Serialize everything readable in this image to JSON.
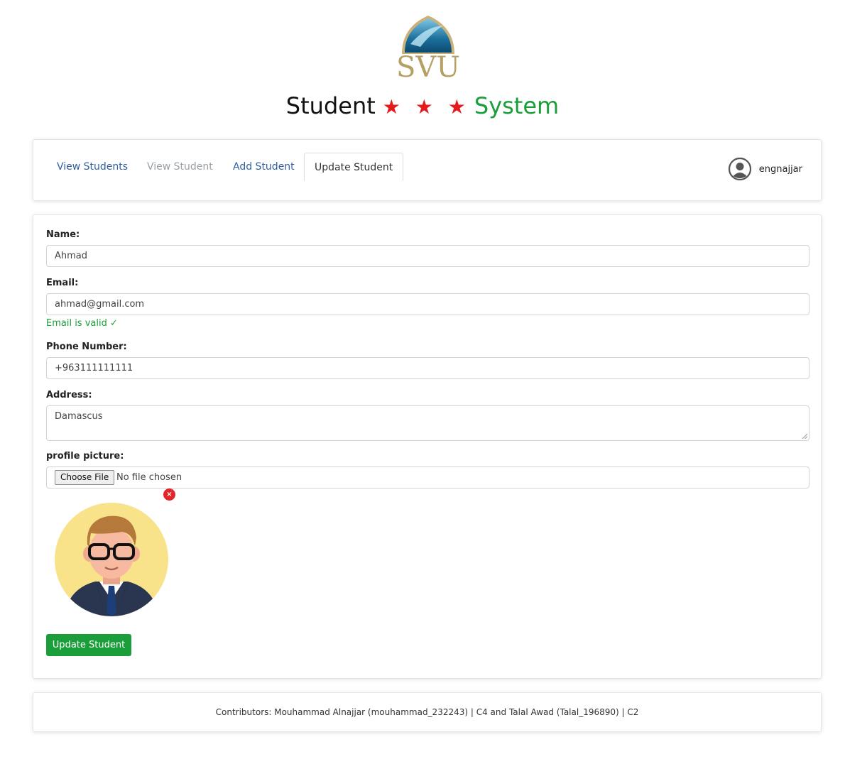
{
  "header": {
    "logo_text": "SVU",
    "title_part1": "Student",
    "stars": "★ ★ ★",
    "title_part2": "System"
  },
  "nav": {
    "tabs": [
      {
        "label": "View Students",
        "state": "link"
      },
      {
        "label": "View Student",
        "state": "disabled"
      },
      {
        "label": "Add Student",
        "state": "link"
      },
      {
        "label": "Update Student",
        "state": "active"
      }
    ],
    "user": {
      "icon": "user-circle-icon",
      "username": "engnajjar"
    }
  },
  "form": {
    "name": {
      "label": "Name:",
      "value": "Ahmad"
    },
    "email": {
      "label": "Email:",
      "value": "ahmad@gmail.com",
      "validation": "Email is valid ✓"
    },
    "phone": {
      "label": "Phone Number:",
      "value": "+963111111111"
    },
    "address": {
      "label": "Address:",
      "value": "Damascus"
    },
    "picture": {
      "label": "profile picture:",
      "button": "Choose File",
      "status": "No file chosen",
      "remove_symbol": "×"
    },
    "submit_label": "Update Student"
  },
  "footer": {
    "text": "Contributors: Mouhammad Alnajjar (mouhammad_232243) | C4 and Talal Awad (Talal_196890) | C2"
  },
  "colors": {
    "accent_green": "#1a9e3a",
    "star_red": "#e41a1c",
    "link_blue": "#2f5f9e"
  }
}
